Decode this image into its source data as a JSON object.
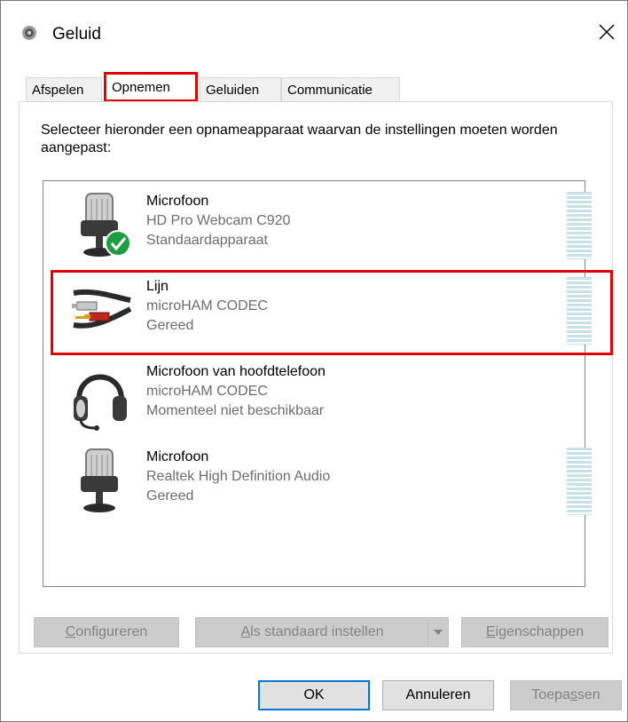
{
  "window": {
    "title": "Geluid",
    "close_symbol": "✕"
  },
  "tabs": [
    {
      "label": "Afspelen",
      "active": false
    },
    {
      "label": "Opnemen",
      "active": true
    },
    {
      "label": "Geluiden",
      "active": false
    },
    {
      "label": "Communicatie",
      "active": false
    }
  ],
  "instructions": "Selecteer hieronder een opnameapparaat waarvan de instellingen moeten worden aangepast:",
  "devices": [
    {
      "name": "Microfoon",
      "description": "HD Pro Webcam C920",
      "status": "Standaardapparaat",
      "icon": "microphone-default-icon",
      "meter": true
    },
    {
      "name": "Lijn",
      "description": "microHAM CODEC",
      "status": "Gereed",
      "icon": "line-in-cable-icon",
      "meter": true
    },
    {
      "name": "Microfoon van hoofdtelefoon",
      "description": "microHAM CODEC",
      "status": "Momenteel niet beschikbaar",
      "icon": "headset-icon",
      "meter": false
    },
    {
      "name": "Microfoon",
      "description": "Realtek High Definition Audio",
      "status": "Gereed",
      "icon": "microphone-icon",
      "meter": true
    }
  ],
  "buttons": {
    "configure": {
      "prefix": "",
      "underline": "C",
      "suffix": "onfigureren"
    },
    "set_default": {
      "prefix": "",
      "underline": "A",
      "suffix": "ls standaard instellen"
    },
    "properties": {
      "prefix": "",
      "underline": "E",
      "suffix": "igenschappen"
    },
    "ok": "OK",
    "cancel": "Annuleren",
    "apply": {
      "prefix": "Toepa",
      "underline": "s",
      "suffix": "sen"
    }
  },
  "colors": {
    "highlight": "#e00000",
    "meter": "#c8e0e8",
    "check": "#1e9e40",
    "focus": "#0078d7"
  }
}
